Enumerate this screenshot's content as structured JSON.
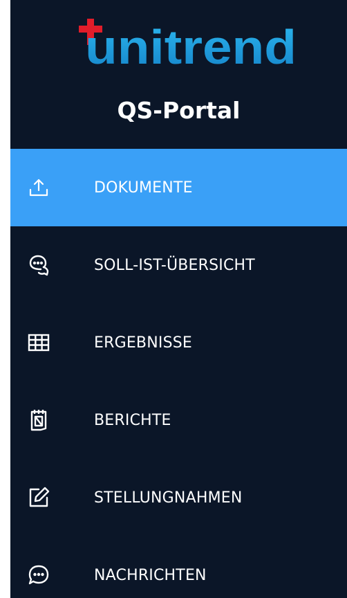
{
  "app": {
    "logo_text": "unitrend",
    "portal_title": "QS-Portal",
    "colors": {
      "sidebar_bg": "#0b1628",
      "active_bg": "#3aa0f7",
      "logo_blue": "#1aa4e4",
      "logo_red": "#e11d2a",
      "text": "#ffffff"
    }
  },
  "nav": {
    "items": [
      {
        "label": "DOKUMENTE",
        "icon": "upload-icon",
        "active": true
      },
      {
        "label": "SOLL-IST-ÜBERSICHT",
        "icon": "chat-bubbles-icon",
        "active": false
      },
      {
        "label": "ERGEBNISSE",
        "icon": "table-grid-icon",
        "active": false
      },
      {
        "label": "BERICHTE",
        "icon": "report-document-icon",
        "active": false
      },
      {
        "label": "STELLUNGNAHMEN",
        "icon": "edit-note-icon",
        "active": false
      },
      {
        "label": "NACHRICHTEN",
        "icon": "message-bubble-icon",
        "active": false
      }
    ]
  }
}
